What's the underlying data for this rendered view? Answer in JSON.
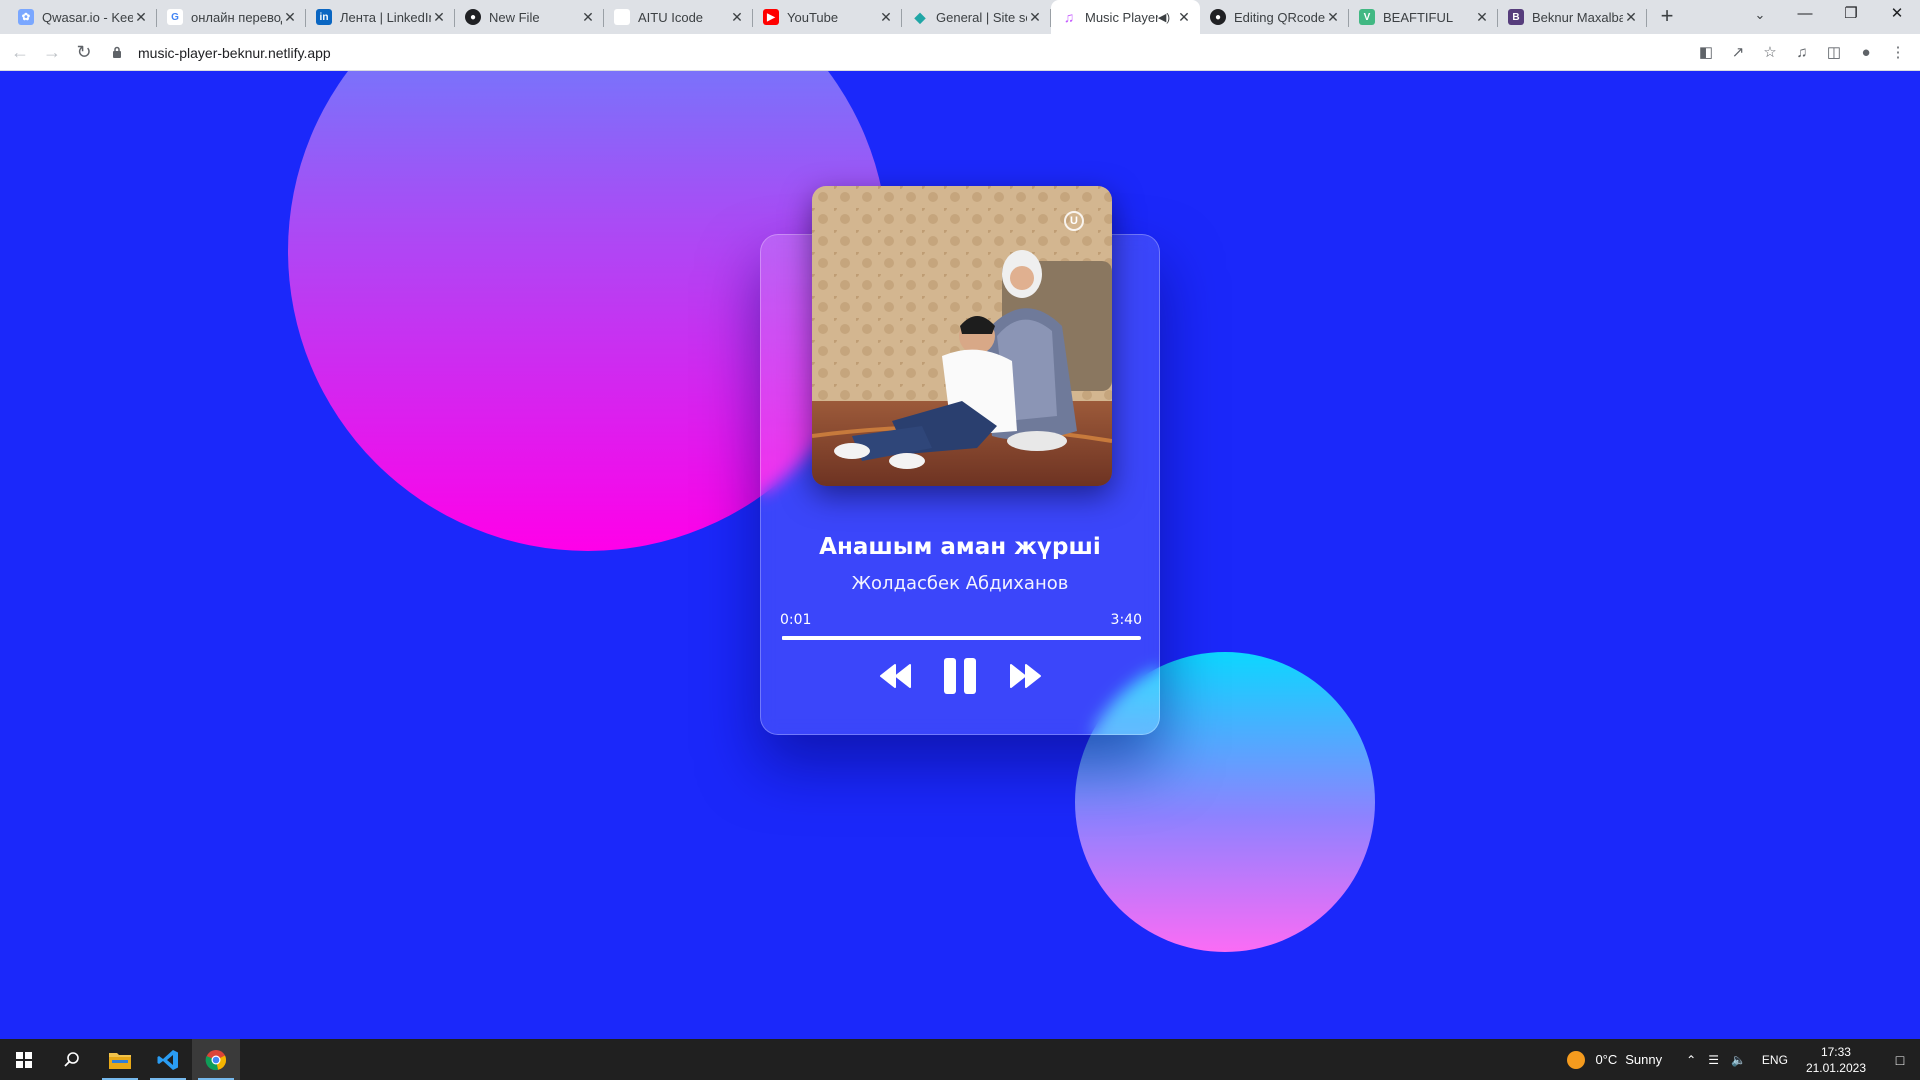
{
  "browser": {
    "tabs": [
      {
        "title": "Qwasar.io - Keep",
        "favicon": "qwasar-icon",
        "color": "#7aa7ff"
      },
      {
        "title": "онлайн переводчик",
        "favicon": "google-icon",
        "color": "#ffffff"
      },
      {
        "title": "Лента | LinkedIn",
        "favicon": "linkedin-icon",
        "color": "#0a66c2"
      },
      {
        "title": "New File",
        "favicon": "github-icon",
        "color": "#202124"
      },
      {
        "title": "AITU Icode",
        "favicon": "blank-page-icon",
        "color": "#ffffff"
      },
      {
        "title": "YouTube",
        "favicon": "youtube-icon",
        "color": "#ff0000"
      },
      {
        "title": "General | Site settings",
        "favicon": "netlify-icon",
        "color": "#20a6a6"
      },
      {
        "title": "Music Player",
        "favicon": "music-note-icon",
        "color": "#c55cff",
        "active": true,
        "muted_icon": "speaker-icon"
      },
      {
        "title": "Editing QRcode",
        "favicon": "github-icon",
        "color": "#202124"
      },
      {
        "title": "BEAFTIFUL",
        "favicon": "vue-icon",
        "color": "#41b883"
      },
      {
        "title": "Beknur Maxalbaev",
        "favicon": "bootstrap-icon",
        "color": "#563d7c"
      }
    ],
    "new_tab_label": "+",
    "url": "music-player-beknur.netlify.app"
  },
  "player": {
    "song_title": "Анашым аман жүрші",
    "artist": "Жолдасбек Абдиханов",
    "current_time": "0:01",
    "duration": "3:40",
    "progress_fraction": 0.005,
    "cover_badge": "U",
    "controls": {
      "previous": "rewind-icon",
      "pause": "pause-icon",
      "next": "fast-forward-icon"
    }
  },
  "colors": {
    "page_background": "#1b28fa",
    "circle_top": [
      "#5590ff",
      "#ff00e9"
    ],
    "circle_bottom": [
      "#0cd7ff",
      "#fb6cf5"
    ]
  },
  "taskbar": {
    "weather_temp": "0°C",
    "weather_text": "Sunny",
    "language": "ENG",
    "time": "17:33",
    "date": "21.01.2023"
  }
}
